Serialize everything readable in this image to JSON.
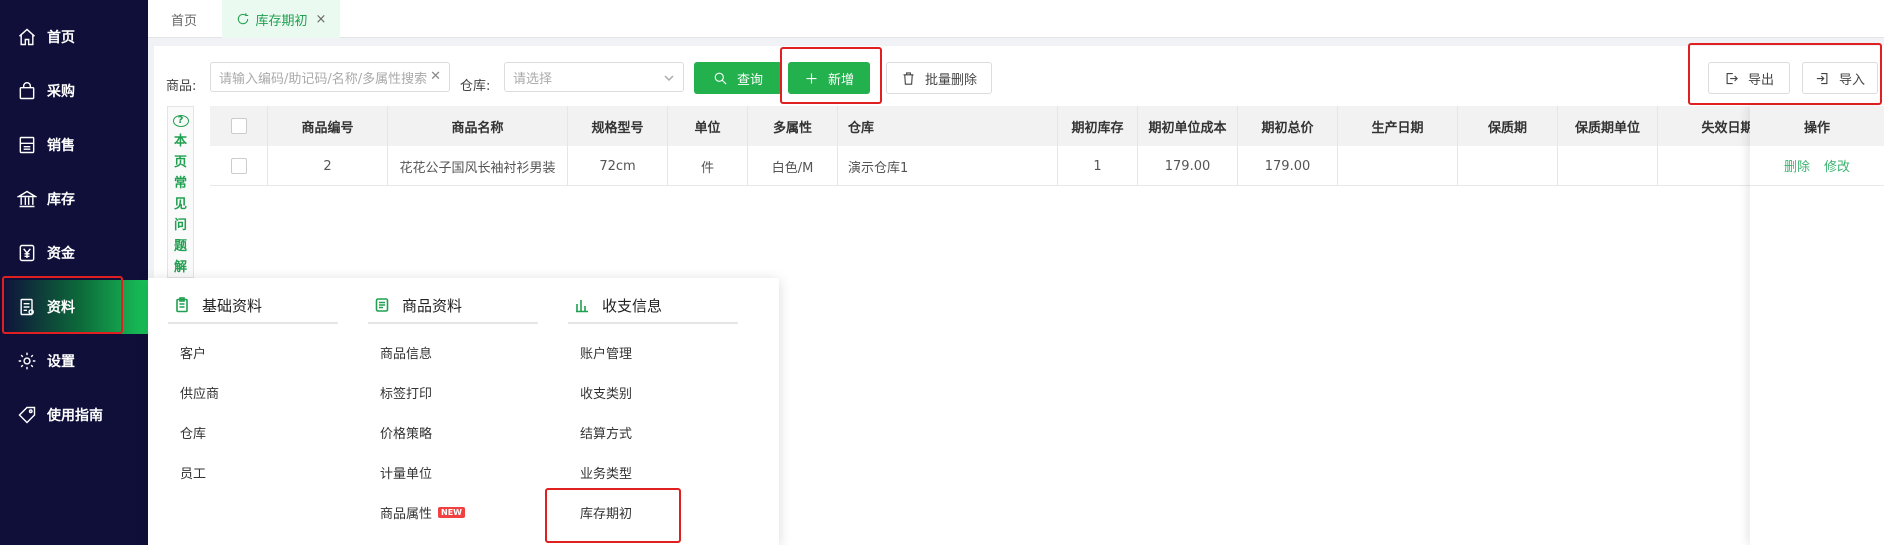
{
  "sidebar": {
    "items": [
      {
        "label": "首页",
        "icon": "home-icon"
      },
      {
        "label": "采购",
        "icon": "shopping-bag-icon"
      },
      {
        "label": "销售",
        "icon": "register-icon"
      },
      {
        "label": "库存",
        "icon": "warehouse-icon"
      },
      {
        "label": "资金",
        "icon": "yen-icon"
      },
      {
        "label": "资料",
        "icon": "document-icon"
      },
      {
        "label": "设置",
        "icon": "gear-icon"
      },
      {
        "label": "使用指南",
        "icon": "tag-icon"
      }
    ],
    "active_index": 5
  },
  "tabs": {
    "home": "首页",
    "active": "库存期初",
    "close": "×"
  },
  "filter": {
    "product_label": "商品:",
    "product_placeholder": "请输入编码/助记码/名称/多属性搜索",
    "warehouse_label": "仓库:",
    "warehouse_placeholder": "请选择",
    "query_btn": "查询",
    "add_btn": "新增",
    "batch_delete_btn": "批量删除",
    "export_btn": "导出",
    "import_btn": "导入"
  },
  "faq": {
    "icon": "?",
    "chars": [
      "本",
      "页",
      "常",
      "见",
      "问",
      "题",
      "解"
    ]
  },
  "table": {
    "headers": [
      "商品编号",
      "商品名称",
      "规格型号",
      "单位",
      "多属性",
      "仓库",
      "期初库存",
      "期初单位成本",
      "期初总价",
      "生产日期",
      "保质期",
      "保质期单位",
      "失效日期"
    ],
    "op_header": "操作",
    "rows": [
      [
        "2",
        "花花公子国风长袖衬衫男装",
        "72cm",
        "件",
        "白色/M",
        "演示仓库1",
        "1",
        "179.00",
        "179.00",
        "",
        "",
        "",
        ""
      ]
    ],
    "row_actions": [
      "删除",
      "修改"
    ]
  },
  "dropdown": {
    "columns": [
      {
        "title": "基础资料",
        "icon": "clipboard-icon",
        "items": [
          {
            "label": "客户"
          },
          {
            "label": "供应商"
          },
          {
            "label": "仓库"
          },
          {
            "label": "员工"
          }
        ]
      },
      {
        "title": "商品资料",
        "icon": "product-list-icon",
        "items": [
          {
            "label": "商品信息"
          },
          {
            "label": "标签打印"
          },
          {
            "label": "价格策略"
          },
          {
            "label": "计量单位"
          },
          {
            "label": "商品属性",
            "badge": "NEW"
          }
        ]
      },
      {
        "title": "收支信息",
        "icon": "bar-chart-icon",
        "items": [
          {
            "label": "账户管理"
          },
          {
            "label": "收支类别"
          },
          {
            "label": "结算方式"
          },
          {
            "label": "业务类型"
          },
          {
            "label": "库存期初"
          }
        ]
      }
    ]
  },
  "colors": {
    "sidebar_bg": "#0f0f3a",
    "accent_green": "#22b14c",
    "highlight_red": "#e02020"
  }
}
